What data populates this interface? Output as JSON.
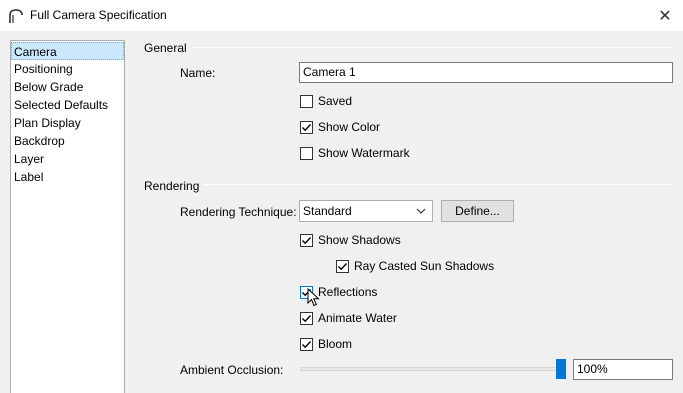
{
  "window": {
    "title": "Full Camera Specification",
    "icon": "camera-arch-icon",
    "close_glyph": "✕"
  },
  "nav": {
    "items": [
      {
        "label": "Camera",
        "selected": true
      },
      {
        "label": "Positioning",
        "selected": false
      },
      {
        "label": "Below Grade",
        "selected": false
      },
      {
        "label": "Selected Defaults",
        "selected": false
      },
      {
        "label": "Plan Display",
        "selected": false
      },
      {
        "label": "Backdrop",
        "selected": false
      },
      {
        "label": "Layer",
        "selected": false
      },
      {
        "label": "Label",
        "selected": false
      }
    ]
  },
  "general": {
    "heading": "General",
    "name_label": "Name:",
    "name_value": "Camera 1",
    "saved": {
      "label": "Saved",
      "checked": false
    },
    "show_color": {
      "label": "Show Color",
      "checked": true
    },
    "show_watermark": {
      "label": "Show Watermark",
      "checked": false
    }
  },
  "rendering": {
    "heading": "Rendering",
    "technique_label": "Rendering Technique:",
    "technique_value": "Standard",
    "define_button": "Define...",
    "show_shadows": {
      "label": "Show Shadows",
      "checked": true
    },
    "ray_casted": {
      "label": "Ray Casted Sun Shadows",
      "checked": true
    },
    "reflections": {
      "label": "Reflections",
      "checked": true
    },
    "animate_water": {
      "label": "Animate Water",
      "checked": true
    },
    "bloom": {
      "label": "Bloom",
      "checked": true
    },
    "ambient_label": "Ambient Occlusion:",
    "ambient_value": "100%",
    "ambient_fraction": 1.0
  },
  "colors": {
    "accent": "#0078d7",
    "selection": "#cce8ff"
  }
}
